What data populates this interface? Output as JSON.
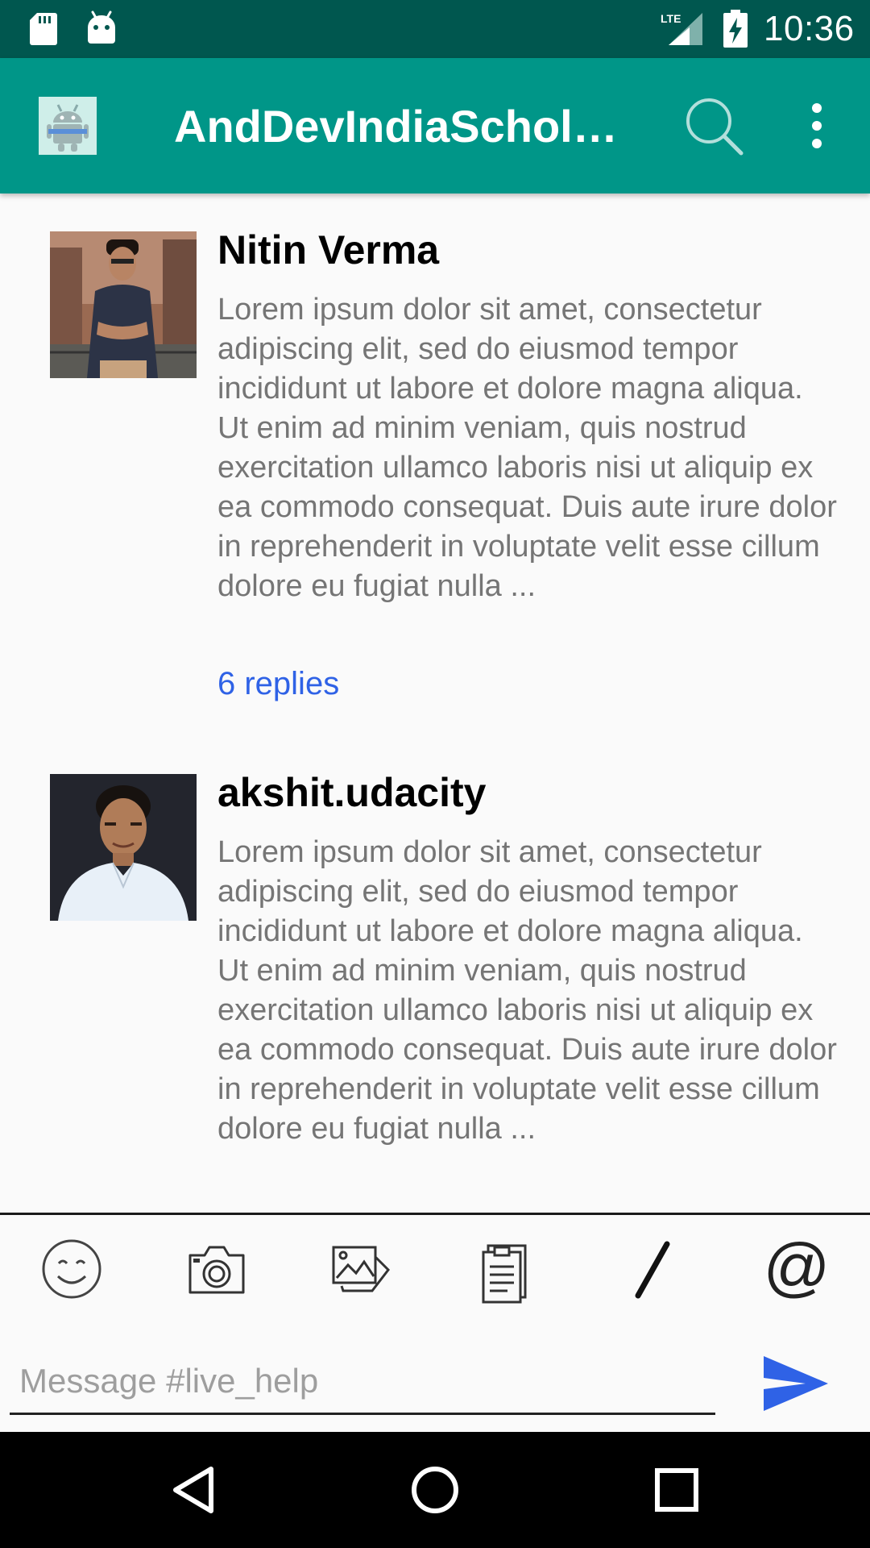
{
  "status_bar": {
    "time": "10:36",
    "network": "LTE",
    "icons": [
      "sd-card-icon",
      "android-icon",
      "lte-signal-icon",
      "battery-charging-icon"
    ]
  },
  "app_bar": {
    "title": "AndDevIndiaScholars",
    "icons": [
      "app-logo",
      "search-icon",
      "more-vert-icon"
    ]
  },
  "messages": [
    {
      "author": "Nitin Verma",
      "text": "Lorem ipsum dolor sit amet, consectetur adipiscing elit, sed do eiusmod tempor incididunt ut labore et dolore magna aliqua. Ut enim ad minim veniam, quis nostrud exercitation ullamco laboris nisi ut aliquip ex ea commodo consequat. Duis aute irure dolor in reprehenderit in voluptate velit esse cillum dolore eu fugiat nulla ...",
      "replies": "6 replies"
    },
    {
      "author": "akshit.udacity",
      "text": "Lorem ipsum dolor sit amet, consectetur adipiscing elit, sed do eiusmod tempor incididunt ut labore et dolore magna aliqua. Ut enim ad minim veniam, quis nostrud exercitation ullamco laboris nisi ut aliquip ex ea commodo consequat. Duis aute irure dolor in reprehenderit in voluptate velit esse cillum dolore eu fugiat nulla ..."
    }
  ],
  "composer": {
    "tools": [
      "emoji-icon",
      "camera-icon",
      "gallery-icon",
      "clipboard-icon",
      "slash-command-icon",
      "mention-icon"
    ],
    "placeholder": "Message #live_help",
    "send_icon": "send-icon"
  },
  "nav_bar": {
    "icons": [
      "back-icon",
      "home-icon",
      "recents-icon"
    ]
  },
  "colors": {
    "status_bar": "#00574f",
    "app_bar": "#009688",
    "link": "#2f62e6",
    "send": "#2f62e6"
  }
}
